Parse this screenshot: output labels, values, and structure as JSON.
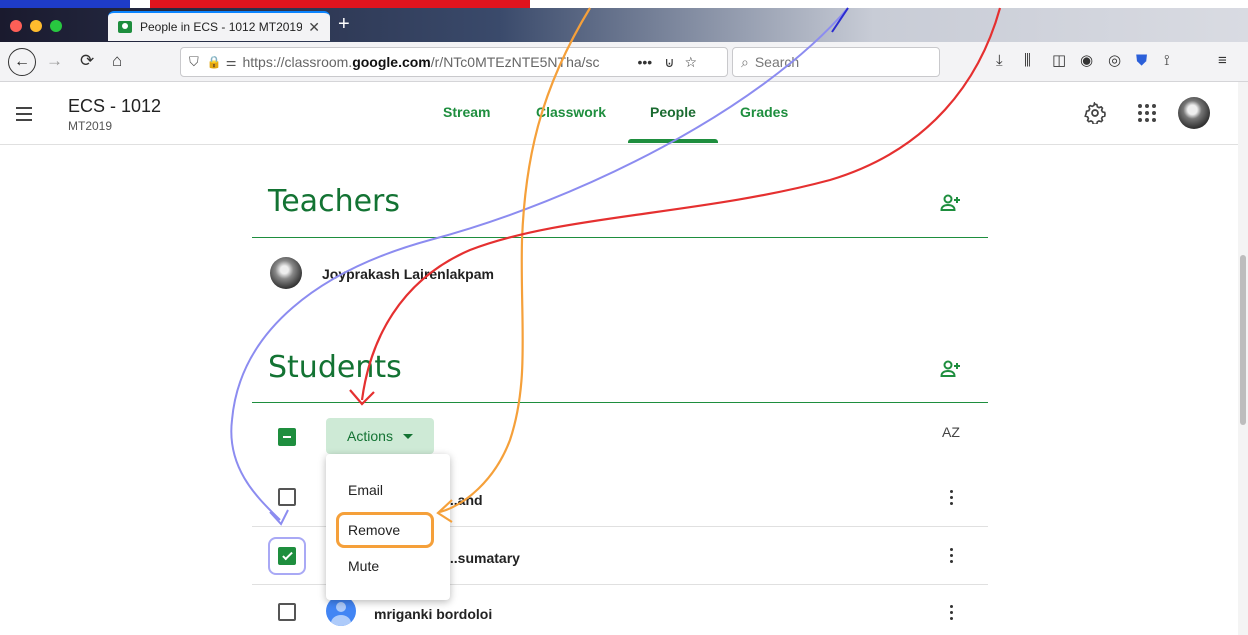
{
  "browser": {
    "tab_title": "People in ECS - 1012 MT2019",
    "tab_close": "✕",
    "new_tab": "+",
    "url_prefix": "https://classroom.",
    "url_domain": "google.com",
    "url_rest": "/r/NTc0MTEzNTE5NTha/sc",
    "url_more": "•••",
    "search_placeholder": "Search"
  },
  "app": {
    "class_name": "ECS - 1012",
    "class_section": "MT2019",
    "tabs": [
      {
        "label": "Stream"
      },
      {
        "label": "Classwork"
      },
      {
        "label": "People"
      },
      {
        "label": "Grades"
      }
    ],
    "active_tab": "People"
  },
  "teachers": {
    "title": "Teachers",
    "list": [
      {
        "name": "Joyprakash Lairenlakpam"
      }
    ]
  },
  "students": {
    "title": "Students",
    "actions_label": "Actions",
    "sort_label": "AZ",
    "list": [
      {
        "name": "...and",
        "checked": false
      },
      {
        "name": "...sumatary",
        "checked": true
      },
      {
        "name": "mriganki bordoloi",
        "checked": false
      }
    ]
  },
  "menu": {
    "items": [
      {
        "label": "Email"
      },
      {
        "label": "Remove"
      },
      {
        "label": "Mute"
      }
    ]
  },
  "colors": {
    "accent_green": "#1e8e3e",
    "annot_orange": "#f5a03a",
    "annot_red": "#e53030",
    "annot_blue": "#8c8cf0"
  }
}
